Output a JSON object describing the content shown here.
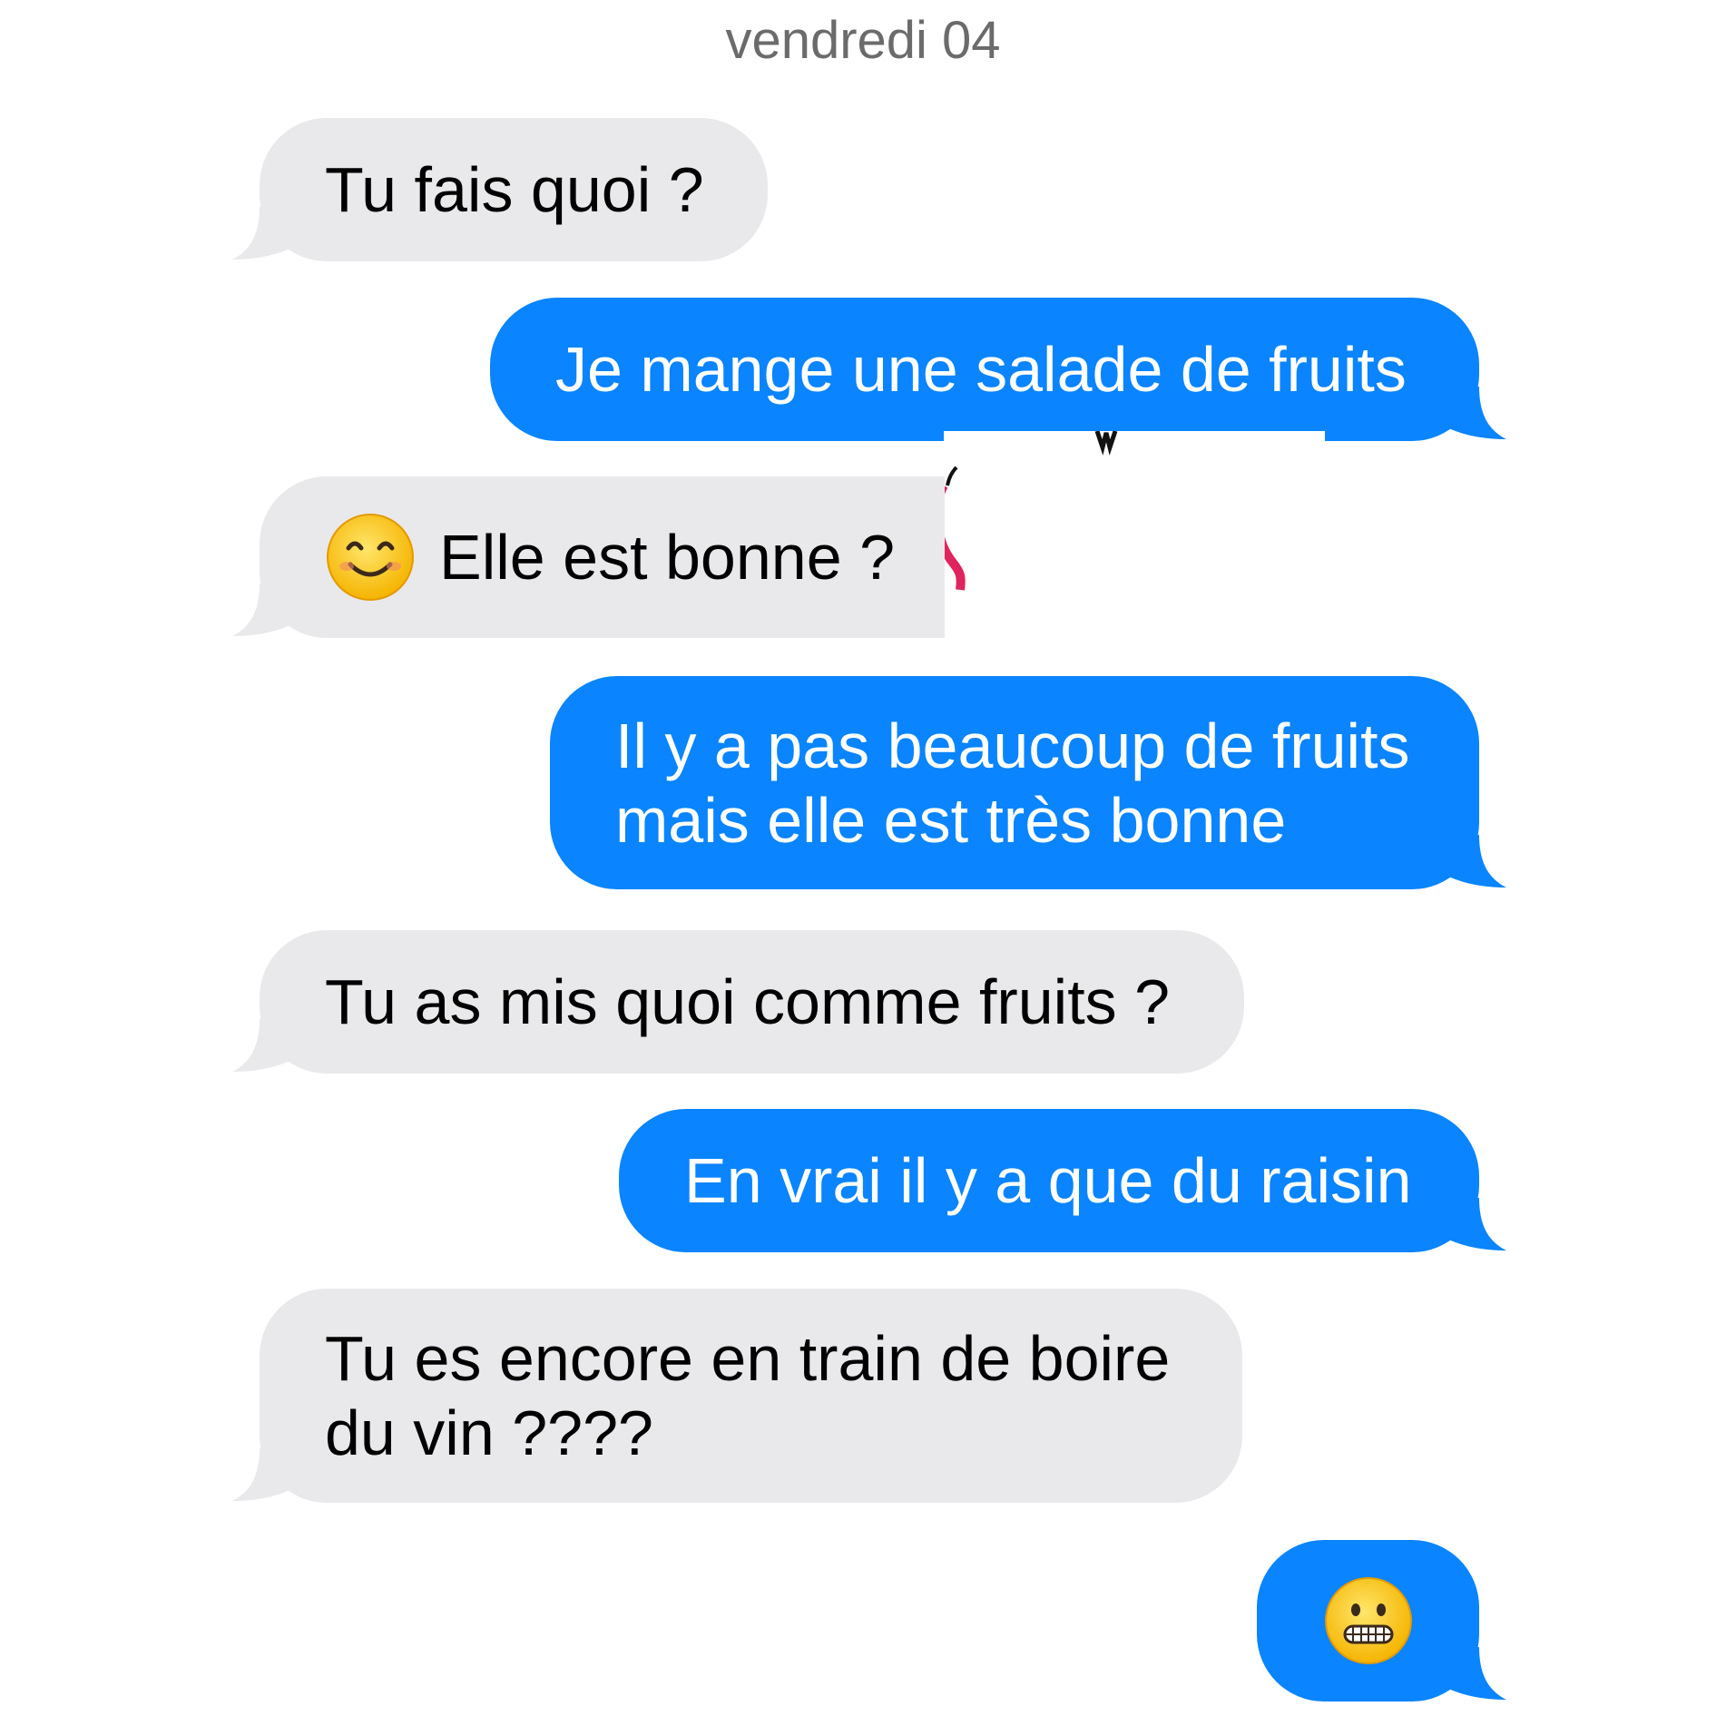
{
  "conversation": {
    "date_header": "vendredi 04",
    "colors": {
      "sent_bubble": "#0a84ff",
      "received_bubble": "#e9e9eb",
      "sent_text": "#ffffff",
      "received_text": "#000000",
      "date_text": "#6b6b6b"
    },
    "messages": [
      {
        "direction": "received",
        "text": "Tu fais quoi ?"
      },
      {
        "direction": "sent",
        "text": "Je mange une salade de fruits"
      },
      {
        "direction": "received",
        "emoji": "smiling-face-with-smiling-eyes-icon",
        "text": "Elle est bonne ?"
      },
      {
        "direction": "sent",
        "lines": [
          "Il y a pas beaucoup de fruits",
          "mais elle est très bonne"
        ]
      },
      {
        "direction": "received",
        "text": "Tu as mis quoi comme fruits ?"
      },
      {
        "direction": "sent",
        "text": "En vrai il y a que du raisin"
      },
      {
        "direction": "received",
        "lines": [
          "Tu es encore en train de boire",
          "du vin ????"
        ]
      },
      {
        "direction": "sent",
        "emoji": "grimacing-face-icon"
      }
    ]
  }
}
